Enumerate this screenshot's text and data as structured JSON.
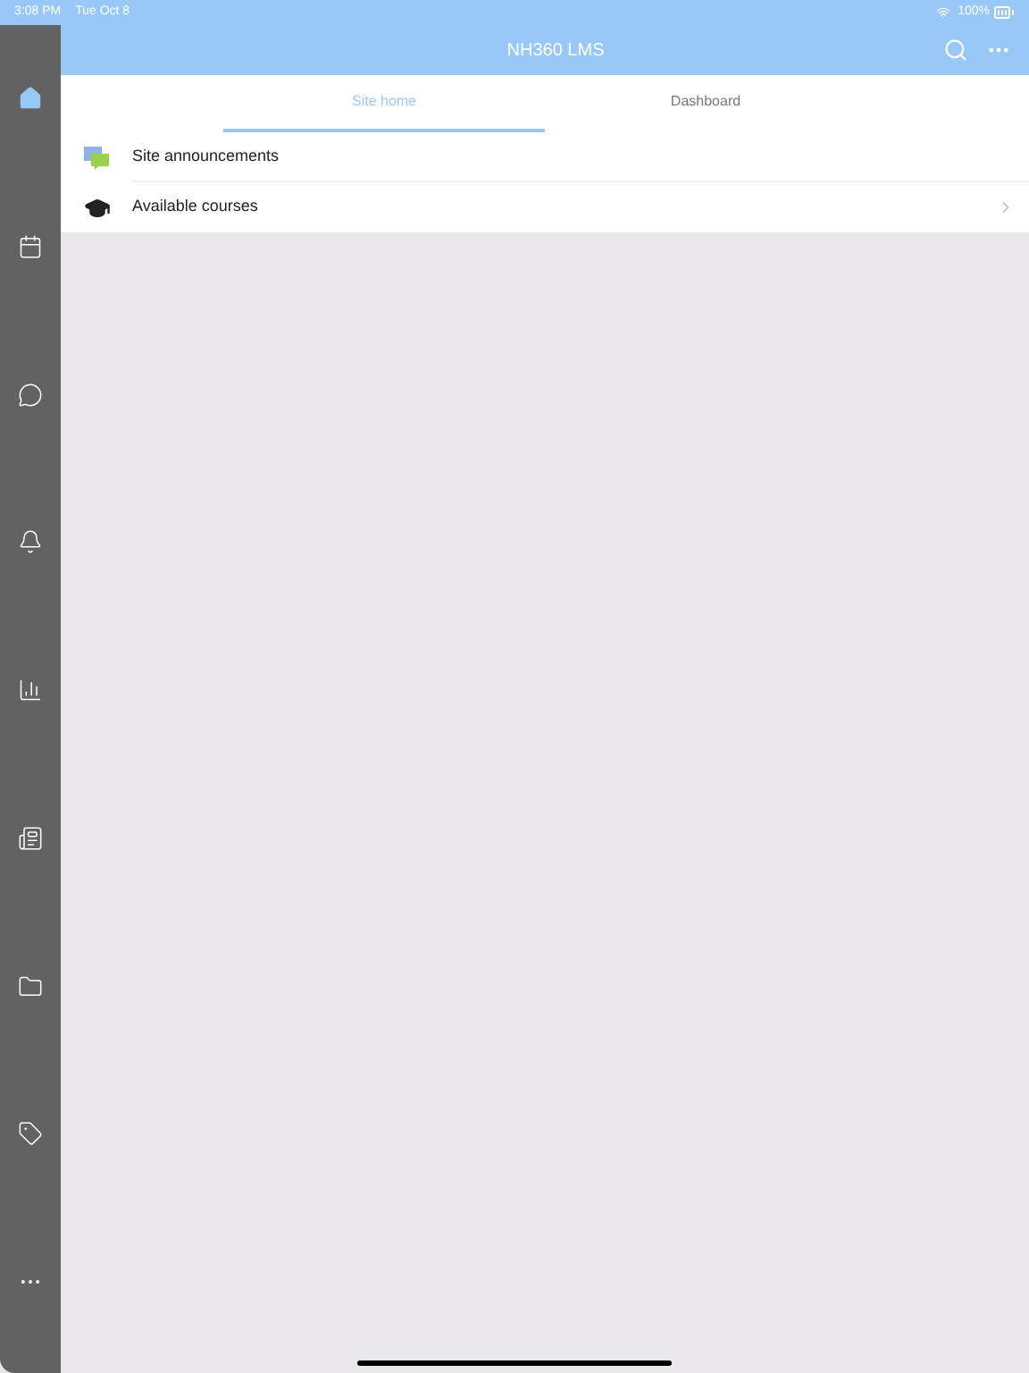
{
  "status_bar": {
    "time": "3:08 PM",
    "date": "Tue Oct 8",
    "battery": "100%"
  },
  "header": {
    "title": "NH360 LMS"
  },
  "sidebar": {
    "items": [
      {
        "selected": true
      },
      {
        "selected": false
      },
      {
        "selected": false
      },
      {
        "selected": false
      },
      {
        "selected": false
      },
      {
        "selected": false
      },
      {
        "selected": false
      },
      {
        "selected": false
      },
      {
        "selected": false
      }
    ]
  },
  "tabs": [
    {
      "label": "Site home",
      "selected": true
    },
    {
      "label": "Dashboard",
      "selected": false
    }
  ],
  "rows": [
    {
      "label": "Site announcements",
      "chevron": false
    },
    {
      "label": "Available courses",
      "chevron": true
    }
  ]
}
